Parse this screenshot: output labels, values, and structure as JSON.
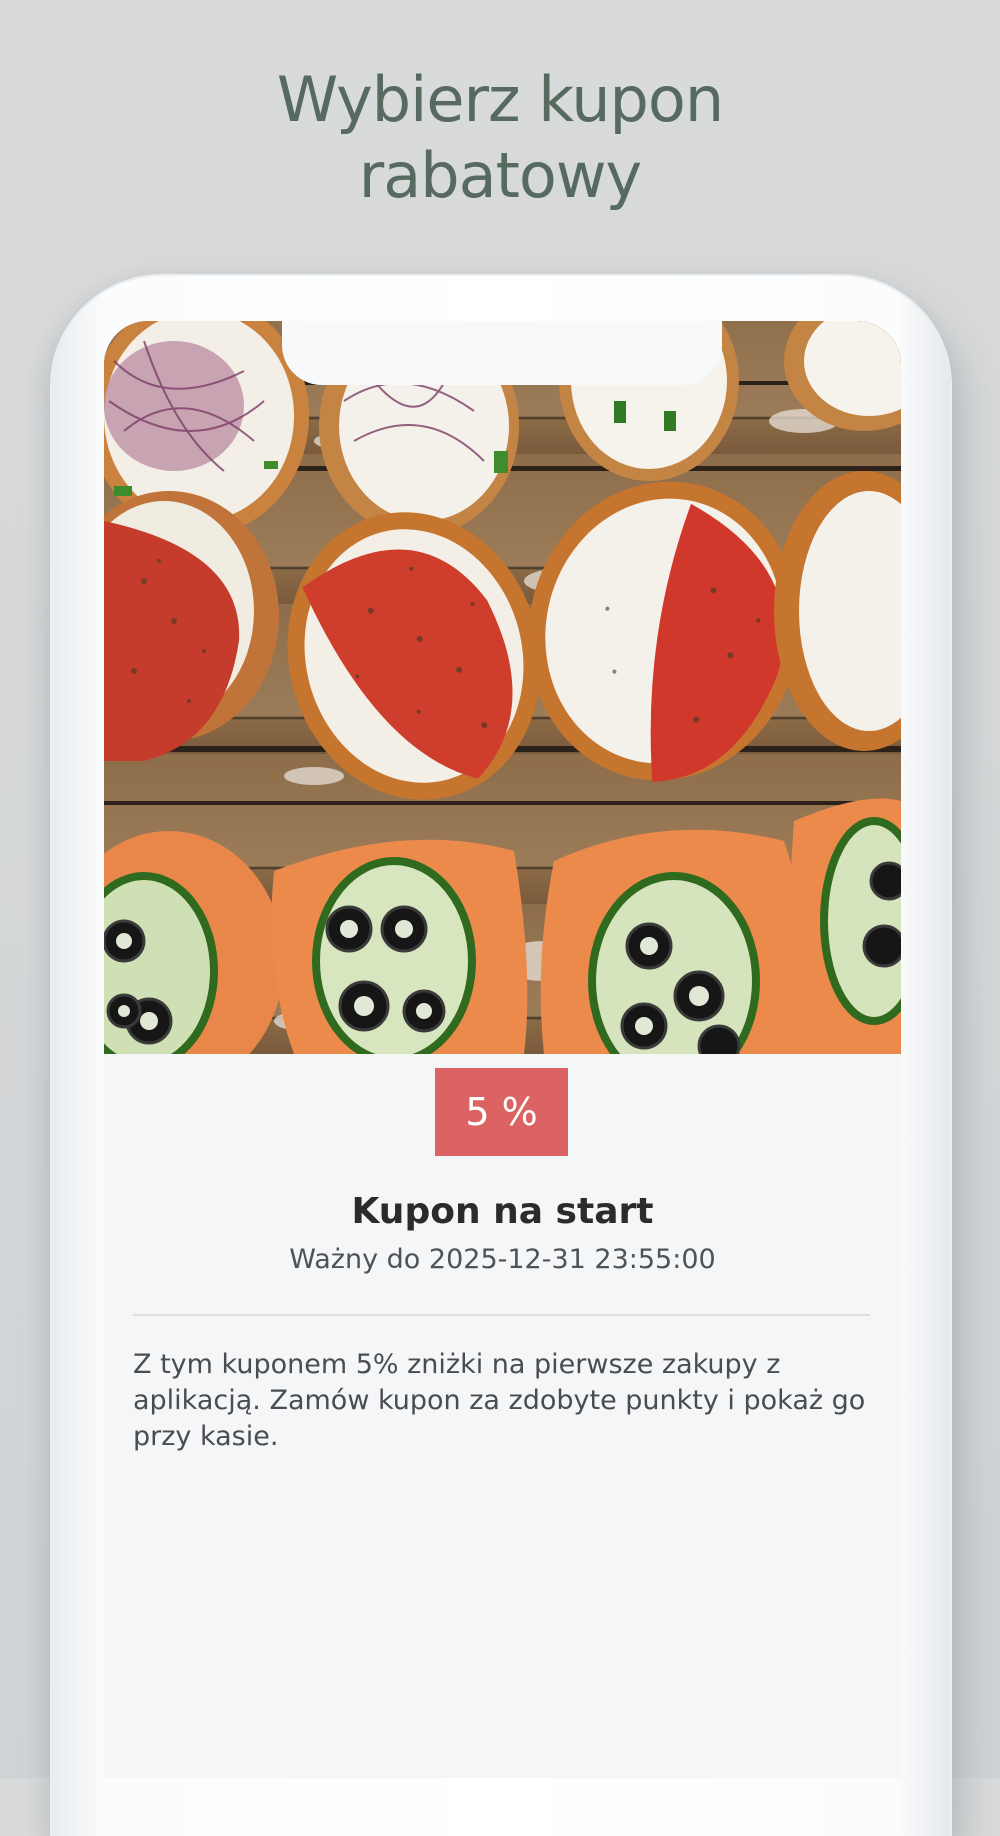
{
  "headline": {
    "line1": "Wybierz kupon",
    "line2": "rabatowy"
  },
  "coupon": {
    "image_alt": "Kanapki z pomidorem, łososiem i ogórkiem",
    "discount": "5 %",
    "title": "Kupon na start",
    "validity_prefix": "Ważny do",
    "valid_until": "2025-12-31 23:55:00",
    "description": "Z tym kuponem 5% zniżki na pierwsze zakupy z aplikacją. Zamów kupon za zdobyte punkty i pokaż go przy kasie."
  },
  "colors": {
    "headline": "#566a60",
    "badge": "#dc6363",
    "screen_bg": "#f5f6f7"
  }
}
